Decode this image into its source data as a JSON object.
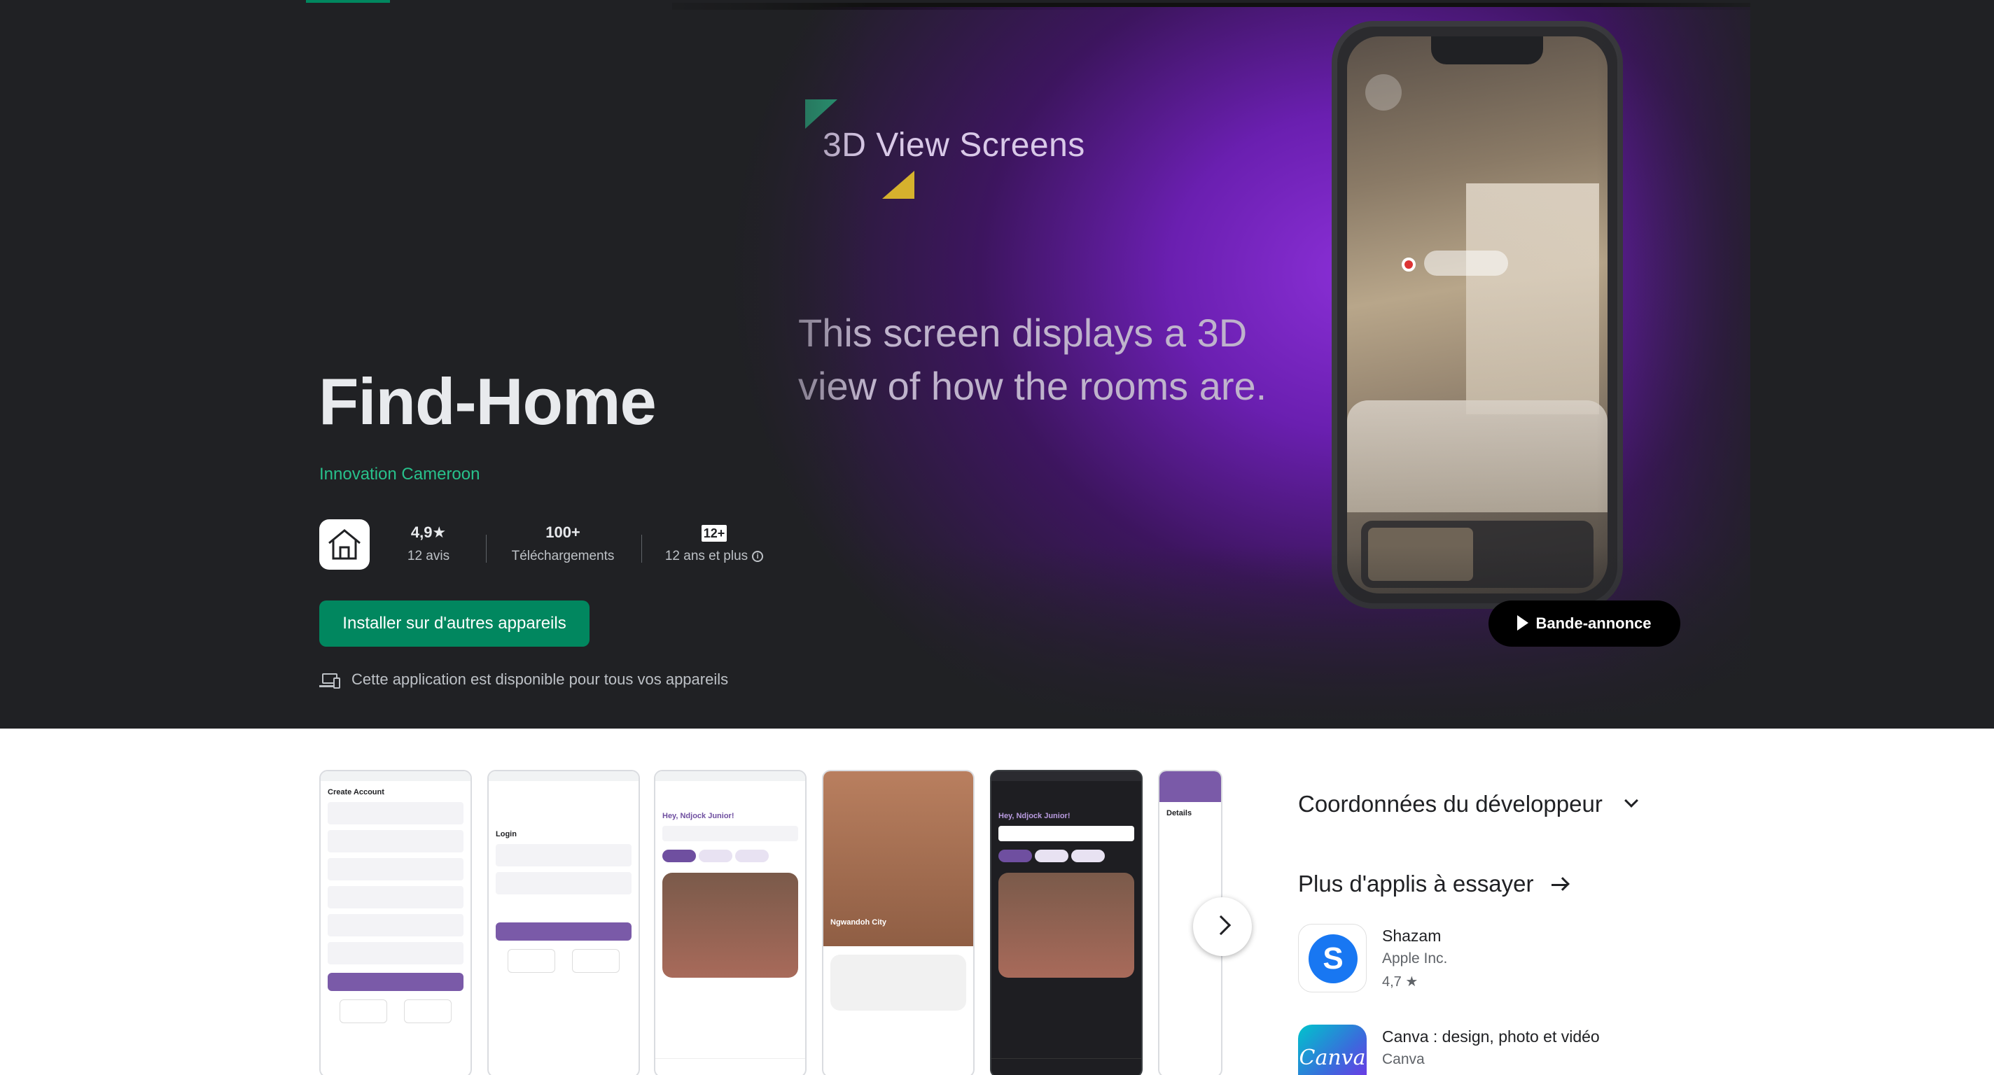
{
  "app": {
    "title": "Find-Home",
    "developer": "Innovation Cameroon",
    "icon": "house-icon"
  },
  "stats": {
    "rating_value": "4,9★",
    "rating_label": "12 avis",
    "downloads_value": "100+",
    "downloads_label": "Téléchargements",
    "age_badge": "12+",
    "age_label": "12 ans et plus"
  },
  "actions": {
    "install_label": "Installer sur d'autres appareils",
    "trailer_label": "Bande-annonce",
    "devices_note": "Cette application est disponible pour tous vos appareils"
  },
  "hero_art": {
    "heading": "3D View Screens",
    "body": "This screen displays a 3D view of how the rooms are."
  },
  "screenshots": [
    {
      "title": "Create Account",
      "theme": "light"
    },
    {
      "title": "Login",
      "theme": "light"
    },
    {
      "title": "Hey, Ndjock Junior!",
      "theme": "light"
    },
    {
      "title": "Ngwandoh City",
      "theme": "light"
    },
    {
      "title": "Hey, Ndjock Junior!",
      "theme": "dark"
    },
    {
      "title": "Details",
      "theme": "light"
    }
  ],
  "sidebar": {
    "developer_contact": "Coordonnées du développeur",
    "more_apps": "Plus d'applis à essayer",
    "apps": [
      {
        "name": "Shazam",
        "developer": "Apple Inc.",
        "rating": "4,7 ★"
      },
      {
        "name": "Canva : design, photo et vidéo",
        "developer": "Canva",
        "rating": ""
      }
    ]
  },
  "colors": {
    "hero_bg": "#202124",
    "accent_green": "#01875f",
    "developer_green": "#28c08b",
    "art_purple": "#8a2fd6"
  }
}
